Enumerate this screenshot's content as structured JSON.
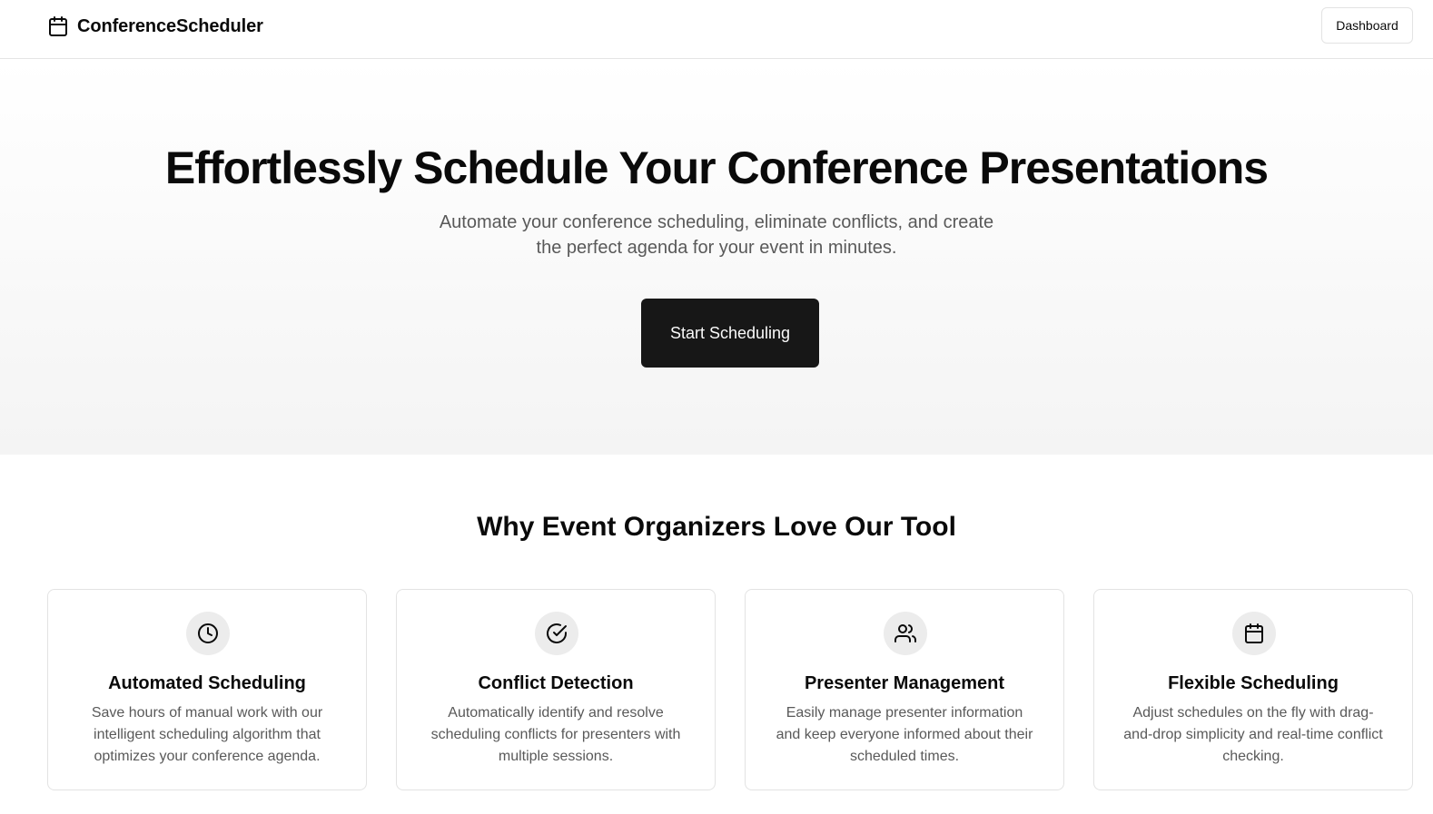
{
  "header": {
    "brand_name": "ConferenceScheduler",
    "brand_icon": "calendar-icon",
    "dashboard_label": "Dashboard"
  },
  "hero": {
    "title": "Effortlessly Schedule Your Conference Presentations",
    "subtitle": "Automate your conference scheduling, eliminate conflicts, and create the perfect agenda for your event in minutes.",
    "cta_label": "Start Scheduling"
  },
  "features": {
    "title": "Why Event Organizers Love Our Tool",
    "cards": [
      {
        "icon": "clock-icon",
        "title": "Automated Scheduling",
        "description": "Save hours of manual work with our intelligent scheduling algorithm that optimizes your conference agenda."
      },
      {
        "icon": "check-circle-icon",
        "title": "Conflict Detection",
        "description": "Automatically identify and resolve scheduling conflicts for presenters with multiple sessions."
      },
      {
        "icon": "users-icon",
        "title": "Presenter Management",
        "description": "Easily manage presenter information and keep everyone informed about their scheduled times."
      },
      {
        "icon": "calendar-icon",
        "title": "Flexible Scheduling",
        "description": "Adjust schedules on the fly with drag-and-drop simplicity and real-time conflict checking."
      }
    ]
  },
  "colors": {
    "primary": "#171717",
    "primary_text": "#fafafa",
    "muted_text": "#595959",
    "border": "#e3e3e3",
    "icon_badge_bg": "#ececec"
  }
}
